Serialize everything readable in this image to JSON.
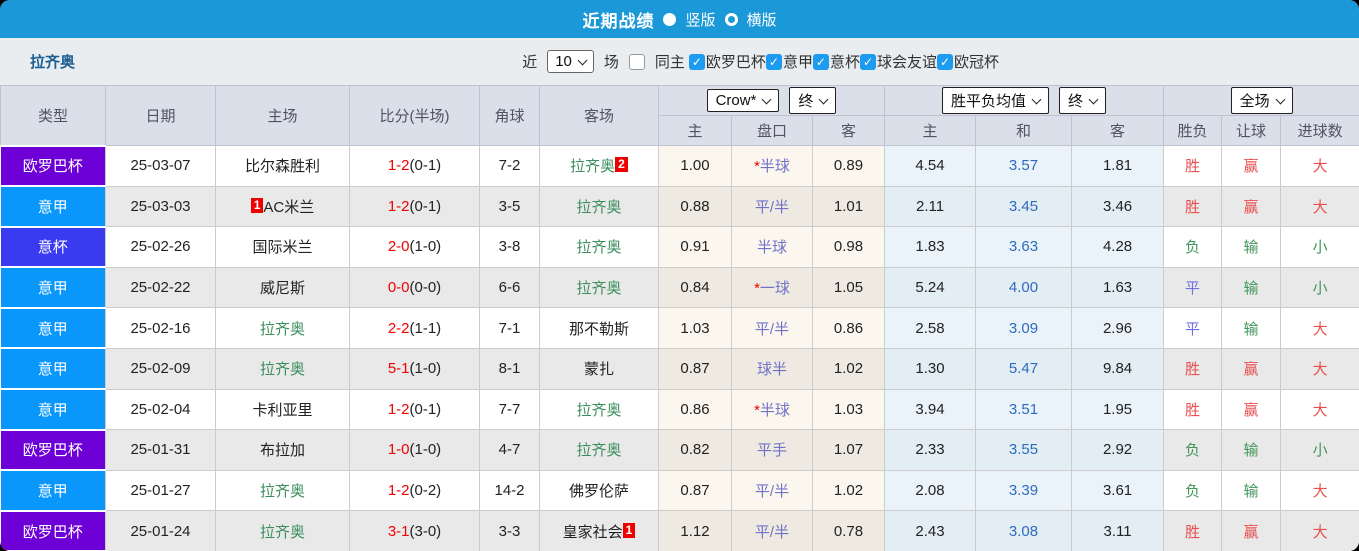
{
  "title_bar": {
    "title": "近期战绩",
    "radio_options": [
      {
        "label": "竖版",
        "selected": false
      },
      {
        "label": "横版",
        "selected": true
      }
    ]
  },
  "filter_bar": {
    "team": "拉齐奥",
    "recent_label": "近",
    "recent_value": "10",
    "games_label": "场",
    "same_home": {
      "label": "同主",
      "checked": false
    },
    "leagues": [
      {
        "label": "欧罗巴杯",
        "checked": true
      },
      {
        "label": "意甲",
        "checked": true
      },
      {
        "label": "意杯",
        "checked": true
      },
      {
        "label": "球会友谊",
        "checked": true
      },
      {
        "label": "欧冠杯",
        "checked": true
      }
    ]
  },
  "colors": {
    "europa": "#6d00d6",
    "seriea": "#0a97fc",
    "coppa": "#3a3af0",
    "win": "#e85050",
    "draw": "#7070e0",
    "lose": "#42965a",
    "team_highlight": "#3c8e5d",
    "accent_blue": "#1b98d8"
  },
  "result_color_keys": {
    "胜": "win",
    "平": "draw",
    "负": "lose",
    "赢": "win",
    "输": "lose",
    "走": "draw",
    "大": "win",
    "小": "lose"
  },
  "table": {
    "selects": {
      "company": "Crow*",
      "company_state": "终",
      "avg": "胜平负均值",
      "avg_state": "终",
      "scope": "全场"
    },
    "column_headers": {
      "type": "类型",
      "date": "日期",
      "home": "主场",
      "score": "比分(半场)",
      "corner": "角球",
      "away": "客场",
      "odds_home": "主",
      "odds_handicap": "盘口",
      "odds_away": "客",
      "avg_win": "主",
      "avg_draw": "和",
      "avg_lose": "客",
      "wdl": "胜负",
      "handicap_result": "让球",
      "goals": "进球数"
    },
    "rows": [
      {
        "type": "欧罗巴杯",
        "type_key": "europa",
        "date": "25-03-07",
        "home": {
          "name": "比尔森胜利",
          "green": false,
          "badge": null
        },
        "score": {
          "full": "1-2",
          "half": "(0-1)"
        },
        "corner": "7-2",
        "away": {
          "name": "拉齐奥",
          "green": true,
          "badge": "2"
        },
        "odds": {
          "home": "1.00",
          "handicap": "*半球",
          "away": "0.89"
        },
        "avg": {
          "win": "4.54",
          "draw": "3.57",
          "lose": "1.81"
        },
        "outcome": {
          "wdl": "胜",
          "handicap": "赢",
          "goals": "大"
        }
      },
      {
        "type": "意甲",
        "type_key": "seriea",
        "date": "25-03-03",
        "home": {
          "name": "AC米兰",
          "green": false,
          "badge": "1"
        },
        "score": {
          "full": "1-2",
          "half": "(0-1)"
        },
        "corner": "3-5",
        "away": {
          "name": "拉齐奥",
          "green": true,
          "badge": null
        },
        "odds": {
          "home": "0.88",
          "handicap": "平/半",
          "away": "1.01"
        },
        "avg": {
          "win": "2.11",
          "draw": "3.45",
          "lose": "3.46"
        },
        "outcome": {
          "wdl": "胜",
          "handicap": "赢",
          "goals": "大"
        }
      },
      {
        "type": "意杯",
        "type_key": "coppa",
        "date": "25-02-26",
        "home": {
          "name": "国际米兰",
          "green": false,
          "badge": null
        },
        "score": {
          "full": "2-0",
          "half": "(1-0)"
        },
        "corner": "3-8",
        "away": {
          "name": "拉齐奥",
          "green": true,
          "badge": null
        },
        "odds": {
          "home": "0.91",
          "handicap": "半球",
          "away": "0.98"
        },
        "avg": {
          "win": "1.83",
          "draw": "3.63",
          "lose": "4.28"
        },
        "outcome": {
          "wdl": "负",
          "handicap": "输",
          "goals": "小"
        }
      },
      {
        "type": "意甲",
        "type_key": "seriea",
        "date": "25-02-22",
        "home": {
          "name": "威尼斯",
          "green": false,
          "badge": null
        },
        "score": {
          "full": "0-0",
          "half": "(0-0)"
        },
        "corner": "6-6",
        "away": {
          "name": "拉齐奥",
          "green": true,
          "badge": null
        },
        "odds": {
          "home": "0.84",
          "handicap": "*一球",
          "away": "1.05"
        },
        "avg": {
          "win": "5.24",
          "draw": "4.00",
          "lose": "1.63"
        },
        "outcome": {
          "wdl": "平",
          "handicap": "输",
          "goals": "小"
        }
      },
      {
        "type": "意甲",
        "type_key": "seriea",
        "date": "25-02-16",
        "home": {
          "name": "拉齐奥",
          "green": true,
          "badge": null
        },
        "score": {
          "full": "2-2",
          "half": "(1-1)"
        },
        "corner": "7-1",
        "away": {
          "name": "那不勒斯",
          "green": false,
          "badge": null
        },
        "odds": {
          "home": "1.03",
          "handicap": "平/半",
          "away": "0.86"
        },
        "avg": {
          "win": "2.58",
          "draw": "3.09",
          "lose": "2.96"
        },
        "outcome": {
          "wdl": "平",
          "handicap": "输",
          "goals": "大"
        }
      },
      {
        "type": "意甲",
        "type_key": "seriea",
        "date": "25-02-09",
        "home": {
          "name": "拉齐奥",
          "green": true,
          "badge": null
        },
        "score": {
          "full": "5-1",
          "half": "(1-0)"
        },
        "corner": "8-1",
        "away": {
          "name": "蒙扎",
          "green": false,
          "badge": null
        },
        "odds": {
          "home": "0.87",
          "handicap": "球半",
          "away": "1.02"
        },
        "avg": {
          "win": "1.30",
          "draw": "5.47",
          "lose": "9.84"
        },
        "outcome": {
          "wdl": "胜",
          "handicap": "赢",
          "goals": "大"
        }
      },
      {
        "type": "意甲",
        "type_key": "seriea",
        "date": "25-02-04",
        "home": {
          "name": "卡利亚里",
          "green": false,
          "badge": null
        },
        "score": {
          "full": "1-2",
          "half": "(0-1)"
        },
        "corner": "7-7",
        "away": {
          "name": "拉齐奥",
          "green": true,
          "badge": null
        },
        "odds": {
          "home": "0.86",
          "handicap": "*半球",
          "away": "1.03"
        },
        "avg": {
          "win": "3.94",
          "draw": "3.51",
          "lose": "1.95"
        },
        "outcome": {
          "wdl": "胜",
          "handicap": "赢",
          "goals": "大"
        }
      },
      {
        "type": "欧罗巴杯",
        "type_key": "europa",
        "date": "25-01-31",
        "home": {
          "name": "布拉加",
          "green": false,
          "badge": null
        },
        "score": {
          "full": "1-0",
          "half": "(1-0)"
        },
        "corner": "4-7",
        "away": {
          "name": "拉齐奥",
          "green": true,
          "badge": null
        },
        "odds": {
          "home": "0.82",
          "handicap": "平手",
          "away": "1.07"
        },
        "avg": {
          "win": "2.33",
          "draw": "3.55",
          "lose": "2.92"
        },
        "outcome": {
          "wdl": "负",
          "handicap": "输",
          "goals": "小"
        }
      },
      {
        "type": "意甲",
        "type_key": "seriea",
        "date": "25-01-27",
        "home": {
          "name": "拉齐奥",
          "green": true,
          "badge": null
        },
        "score": {
          "full": "1-2",
          "half": "(0-2)"
        },
        "corner": "14-2",
        "away": {
          "name": "佛罗伦萨",
          "green": false,
          "badge": null
        },
        "odds": {
          "home": "0.87",
          "handicap": "平/半",
          "away": "1.02"
        },
        "avg": {
          "win": "2.08",
          "draw": "3.39",
          "lose": "3.61"
        },
        "outcome": {
          "wdl": "负",
          "handicap": "输",
          "goals": "大"
        }
      },
      {
        "type": "欧罗巴杯",
        "type_key": "europa",
        "date": "25-01-24",
        "home": {
          "name": "拉齐奥",
          "green": true,
          "badge": null
        },
        "score": {
          "full": "3-1",
          "half": "(3-0)"
        },
        "corner": "3-3",
        "away": {
          "name": "皇家社会",
          "green": false,
          "badge": "1"
        },
        "odds": {
          "home": "1.12",
          "handicap": "平/半",
          "away": "0.78"
        },
        "avg": {
          "win": "2.43",
          "draw": "3.08",
          "lose": "3.11"
        },
        "outcome": {
          "wdl": "胜",
          "handicap": "赢",
          "goals": "大"
        }
      }
    ]
  }
}
